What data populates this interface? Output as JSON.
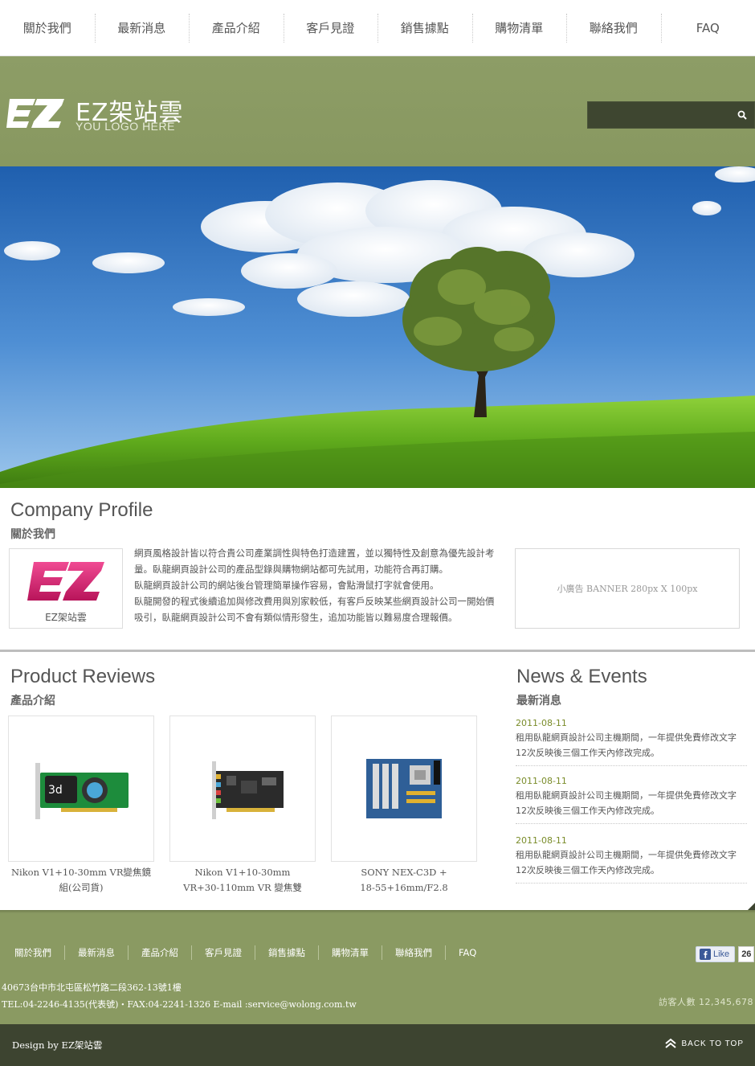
{
  "topnav": {
    "items": [
      "關於我們",
      "最新消息",
      "產品介紹",
      "客戶見證",
      "銷售據點",
      "購物清單",
      "聯絡我們",
      "FAQ"
    ]
  },
  "header": {
    "logo_mark": "EZ",
    "logo_name": "EZ架站雲",
    "logo_sub": "YOU LOGO HERE",
    "search_placeholder": "",
    "search_icon": "search-icon"
  },
  "profile": {
    "title": "Company Profile",
    "subtitle": "關於我們",
    "logo_caption": "EZ架站雲",
    "paragraphs": [
      "網頁風格設計皆以符合貴公司產業調性與特色打造建置，並以獨特性及創意為優先設計考量。臥龍網頁設計公司的產品型錄與購物網站都可先試用，功能符合再訂購。",
      "臥龍網頁設計公司的網站後台管理簡單操作容易，會點滑鼠打字就會使用。",
      "臥龍開發的程式後續追加與修改費用與別家較低，有客戶反映某些網頁設計公司一開始價吸引，臥龍網頁設計公司不會有類似情形發生，追加功能皆以難易度合理報價。"
    ],
    "ad_text": "小廣告 BANNER  280px X 100px"
  },
  "products": {
    "title": "Product Reviews",
    "subtitle": "產品介紹",
    "items": [
      {
        "name_line1": "Nikon V1+10-30mm VR變焦鏡",
        "name_line2": "組(公司貨)"
      },
      {
        "name_line1": "Nikon V1+10-30mm",
        "name_line2": "VR+30-110mm VR 變焦雙"
      },
      {
        "name_line1": "SONY NEX-C3D +",
        "name_line2": "18-55+16mm/F2.8"
      }
    ]
  },
  "news": {
    "title": "News & Events",
    "subtitle": "最新消息",
    "items": [
      {
        "date": "2011-08-11",
        "text": "租用臥龍網頁設計公司主機期間，一年提供免費修改文字12次反映後三個工作天內修改完成。"
      },
      {
        "date": "2011-08-11",
        "text": "租用臥龍網頁設計公司主機期間，一年提供免費修改文字12次反映後三個工作天內修改完成。"
      },
      {
        "date": "2011-08-11",
        "text": "租用臥龍網頁設計公司主機期間，一年提供免費修改文字12次反映後三個工作天內修改完成。"
      }
    ]
  },
  "footer": {
    "nav": [
      "關於我們",
      "最新消息",
      "產品介紹",
      "客戶見證",
      "銷售據點",
      "購物清單",
      "聯絡我們",
      "FAQ"
    ],
    "fb_like": "Like",
    "fb_count": "26",
    "address": "40673台中市北屯區松竹路二段362-13號1樓",
    "contact": "TEL:04-2246-4135(代表號)・FAX:04-2241-1326    E-mail :service@wolong.com.tw",
    "visitors": "訪客人數  12,345,678",
    "design": "Design by EZ架站雲",
    "back_to_top": "BACK TO TOP"
  },
  "colors": {
    "header_bg": "#8a9a62",
    "bottom_bar": "#3d4430",
    "news_date": "#7a8c2a",
    "ez_pink": "#d6286f"
  }
}
